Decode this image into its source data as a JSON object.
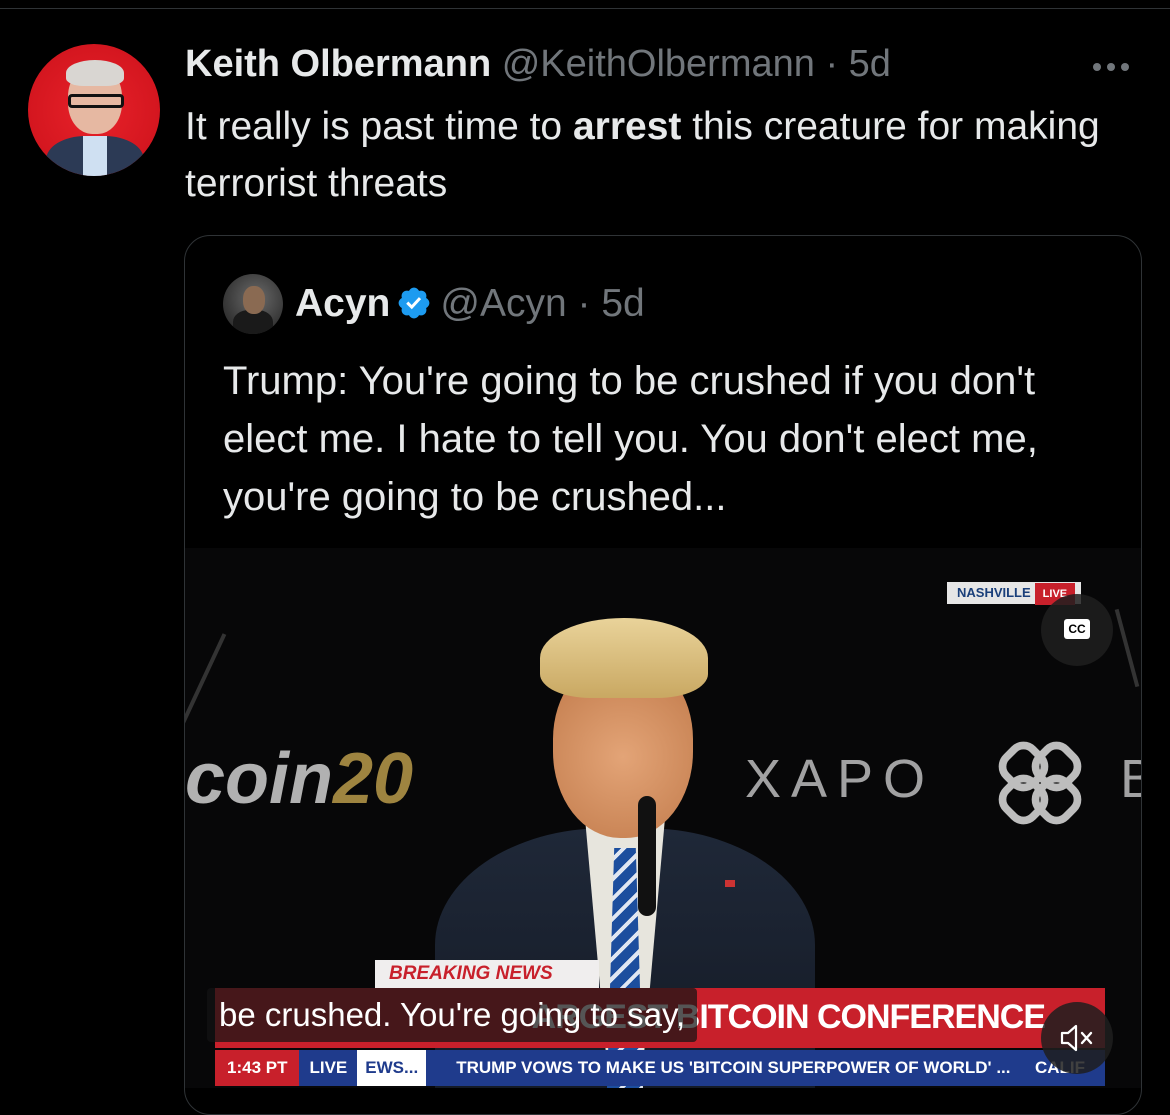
{
  "tweet": {
    "author_name": "Keith Olbermann",
    "handle": "@KeithOlbermann",
    "separator": " · ",
    "time": "5d",
    "text_before": "It really is past time to ",
    "text_bold": "arrest",
    "text_after": " this creature for making terrorist threats"
  },
  "quoted": {
    "author_name": "Acyn",
    "handle": "@Acyn",
    "separator": " · ",
    "time": "5d",
    "text": "Trump: You're going to be crushed if you don't elect me. I hate to tell you. You don't elect me, you're going to be crushed..."
  },
  "video": {
    "stage_logo_left": "coin",
    "stage_logo_year": "20",
    "stage_logo_xapo": "XAPO",
    "stage_logo_b": "B",
    "location": "NASHVILLE",
    "location_live": "LIVE",
    "cc_label": "CC",
    "breaking": "BREAKING NEWS",
    "banner_visible": "ARGEST BITCOIN CONFERENCE",
    "ticker_time": "1:43 PT",
    "ticker_live": "LIVE",
    "ticker_ews": "EWS...",
    "ticker_msg": "TRUMP VOWS TO MAKE US 'BITCOIN SUPERPOWER OF WORLD' ...",
    "ticker_right": "CALIF",
    "caption": "be crushed. You're going to say,"
  },
  "icons": {
    "more": "more-icon",
    "verified": "verified-icon",
    "cc": "cc-icon",
    "mute": "mute-icon"
  },
  "colors": {
    "background": "#000000",
    "text": "#e7e9ea",
    "muted": "#71767b",
    "verified": "#1d9bf0",
    "news_red": "#c8202b",
    "news_blue": "#1f3b8c"
  }
}
